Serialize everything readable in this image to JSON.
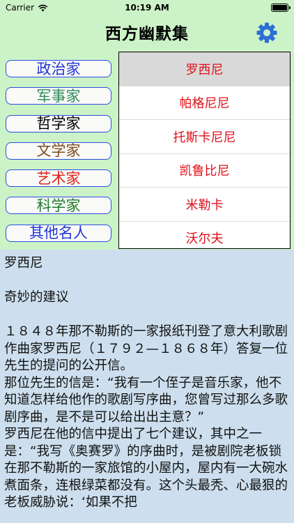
{
  "status_bar": {
    "carrier": "Carrier",
    "time": "10:19 AM"
  },
  "nav": {
    "title": "西方幽默集"
  },
  "categories": [
    {
      "label": "政治家"
    },
    {
      "label": "军事家"
    },
    {
      "label": "哲学家"
    },
    {
      "label": "文学家"
    },
    {
      "label": "艺术家"
    },
    {
      "label": "科学家"
    },
    {
      "label": "其他名人"
    }
  ],
  "people": [
    {
      "name": "罗西尼"
    },
    {
      "name": "帕格尼尼"
    },
    {
      "name": "托斯卡尼尼"
    },
    {
      "name": "凯鲁比尼"
    },
    {
      "name": "米勒卡"
    },
    {
      "name": "沃尔夫"
    }
  ],
  "article": {
    "name": "罗西尼",
    "title": "奇妙的建议",
    "paragraphs": [
      "１８４８年那不勒斯的一家报纸刊登了意大利歌剧作曲家罗西尼（１７９２—１８６８年）答复一位先生的提问的公开信。",
      "那位先生的信是：“我有一个侄子是音乐家，他不知道怎样给他作的歌剧写序曲，您曾写过那么多歌剧序曲，是不是可以给出出主意？”",
      "罗西尼在他的信中提出了七个建议，其中之一是：“我写《奥赛罗》的序曲时，是被剧院老板锁在那不勒斯的一家旅馆的小屋内，屋内有一大碗水煮面条，连根绿菜都没有。这个头最秃、心最狠的老板威胁说：‘如果不把"
    ]
  },
  "colors": {
    "background": "#ccf3c7",
    "text_area_bg": "#cddfee",
    "accent_blue": "#2b6fd6",
    "person_red": "#e0101a"
  }
}
